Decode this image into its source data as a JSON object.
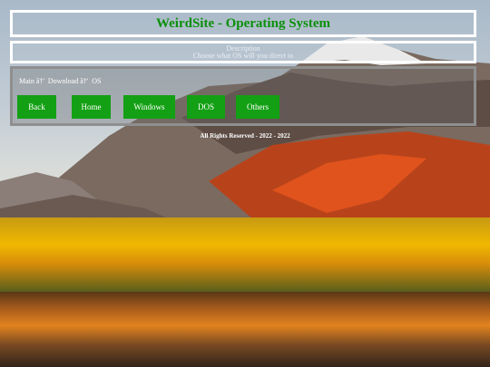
{
  "header": {
    "title": "WeirdSite - Operating System"
  },
  "description": {
    "line1": "Description",
    "line2": "Choose what OS will you direct to"
  },
  "breadcrumb": {
    "items": [
      "Main â†'",
      "Download â†'",
      "OS"
    ]
  },
  "nav": {
    "buttons": [
      "Back",
      "Home",
      "Windows",
      "DOS",
      "Others"
    ]
  },
  "footer": {
    "text": "All Rights Reserved - 2022 - 2022"
  },
  "colors": {
    "title": "#0b8f0b",
    "button_bg": "#14a014",
    "border": "#ffffff"
  }
}
